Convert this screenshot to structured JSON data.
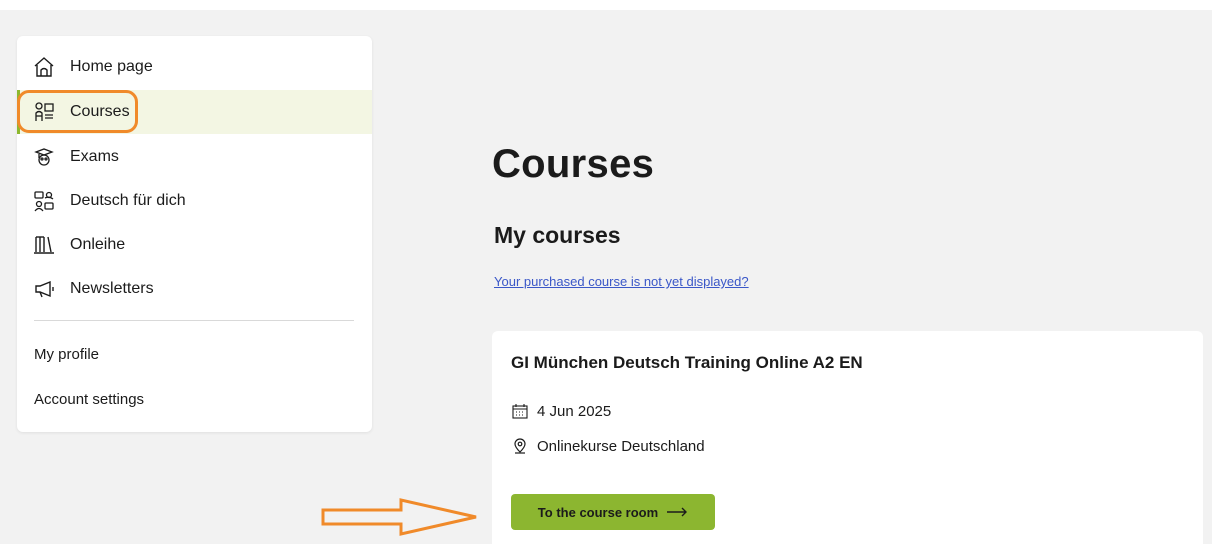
{
  "sidebar": {
    "nav": [
      {
        "label": "Home page",
        "icon": "home-icon"
      },
      {
        "label": "Courses",
        "icon": "courses-icon",
        "active": true
      },
      {
        "label": "Exams",
        "icon": "exams-icon"
      },
      {
        "label": "Deutsch für dich",
        "icon": "community-icon"
      },
      {
        "label": "Onleihe",
        "icon": "library-icon"
      },
      {
        "label": "Newsletters",
        "icon": "megaphone-icon"
      }
    ],
    "links": [
      {
        "label": "My profile"
      },
      {
        "label": "Account settings"
      }
    ]
  },
  "main": {
    "title": "Courses",
    "section_title": "My courses",
    "help_link": "Your purchased course is not yet displayed?",
    "course": {
      "title": "GI München Deutsch Training Online A2 EN",
      "date": "4 Jun 2025",
      "location": "Onlinekurse Deutschland",
      "cta_label": "To the course room"
    }
  },
  "colors": {
    "accent": "#8cb630",
    "active_bg": "#f3f6e3",
    "annotation": "#f08a2a",
    "link": "#3a57c8"
  }
}
